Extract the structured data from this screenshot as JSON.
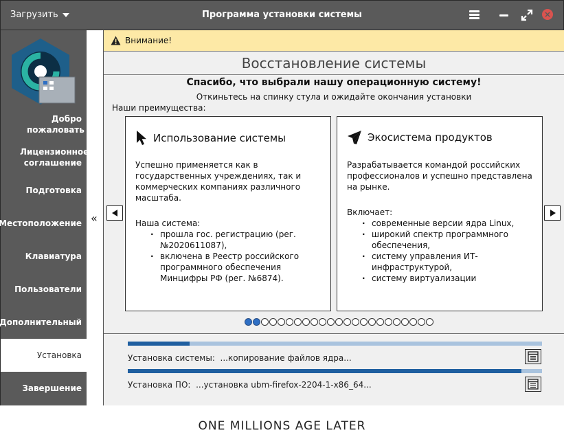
{
  "titlebar": {
    "load_label": "Загрузить",
    "title": "Программа установки системы"
  },
  "sidebar": {
    "items": [
      {
        "label": "Добро пожаловать"
      },
      {
        "label": "Лицензионное соглашение"
      },
      {
        "label": "Подготовка"
      },
      {
        "label": "Местоположение"
      },
      {
        "label": "Клавиатура"
      },
      {
        "label": "Пользователи"
      },
      {
        "label": "Дополнительный"
      },
      {
        "label": "Установка",
        "active": true
      },
      {
        "label": "Завершение"
      }
    ],
    "collapse_glyph": "«"
  },
  "main": {
    "warning": "Внимание!",
    "heading": "Восстановление системы",
    "thanks": "Спасибо, что выбрали нашу операционную систему!",
    "lean_back": "Откиньтесь на спинку стула и ожидайте окончания установки",
    "advantages": "Наши преимущества:",
    "cards": [
      {
        "title": "Использование системы",
        "icon": "cursor-icon",
        "intro": "Успешно применяется как в государственных учреждениях, так и коммерческих компаниях различного масштаба.",
        "list_title": "Наша система:",
        "items": [
          "прошла гос. регистрацию (рег. №2020611087),",
          "включена в Реестр российского программного обеспечения Минцифры РФ (рег. №6874)."
        ]
      },
      {
        "title": "Экосистема продуктов",
        "icon": "paper-plane-icon",
        "intro": "Разрабатывается командой российских профессионалов и успешно представлена на рынке.",
        "list_title": "Включает:",
        "items": [
          "современные версии ядра Linux,",
          "широкий спектр программного обеспечения,",
          "систему управления ИТ-инфраструктурой,",
          "систему виртуализации"
        ]
      }
    ],
    "slides_total": 23,
    "slides_filled": 2
  },
  "progress": {
    "system": {
      "label": "Установка системы:",
      "status": "...копирование файлов ядра...",
      "fraction": 0.15
    },
    "software": {
      "label": "Установка ПО:",
      "status": "...установка ubm-firefox-2204-1-x86_64...",
      "fraction": 0.95
    }
  },
  "caption": "ONE MILLIONS AGE LATER",
  "colors": {
    "sidebar": "#5a5a5a",
    "warning_bg": "#fde9a6",
    "progress_fill": "#1f5fa0",
    "progress_track": "#a9c3de",
    "dot_active": "#2e6fc4",
    "close_button": "#d9534f"
  }
}
